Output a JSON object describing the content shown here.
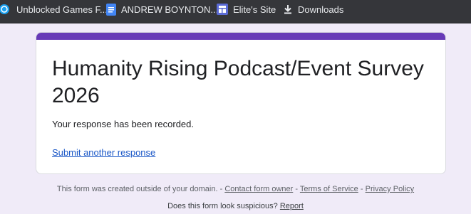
{
  "bookmarks": [
    {
      "label": "Unblocked Games F...",
      "icon": "blue-globe-icon"
    },
    {
      "label": "ANDREW BOYNTON...",
      "icon": "google-docs-icon"
    },
    {
      "label": "Elite's Site",
      "icon": "google-sites-icon"
    },
    {
      "label": "Downloads",
      "icon": "download-icon"
    }
  ],
  "form": {
    "title": "Humanity Rising Podcast/Event Survey 2026",
    "confirmation": "Your response has been recorded.",
    "submit_another": "Submit another response",
    "accent_color": "#673ab7"
  },
  "footer": {
    "notice": "This form was created outside of your domain. -",
    "contact_owner": "Contact form owner",
    "sep1": "-",
    "terms": "Terms of Service",
    "sep2": "-",
    "privacy": "Privacy Policy",
    "suspicious": "Does this form look suspicious?",
    "report": "Report"
  }
}
